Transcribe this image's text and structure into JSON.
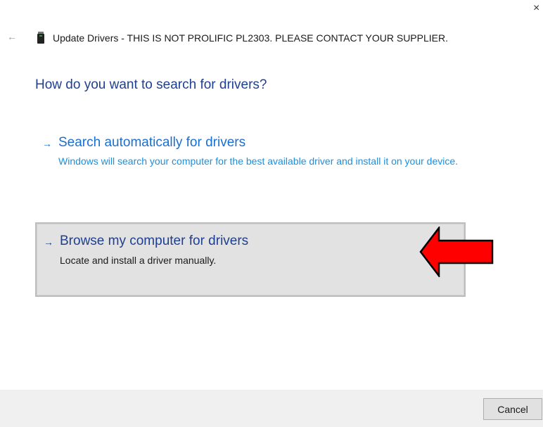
{
  "window": {
    "close_glyph": "×",
    "back_glyph": "←",
    "device_icon": "usb-device-icon",
    "title": "Update Drivers - THIS IS NOT PROLIFIC PL2303. PLEASE CONTACT YOUR SUPPLIER."
  },
  "main": {
    "question": "How do you want to search for drivers?",
    "options": [
      {
        "arrow": "→",
        "title": "Search automatically for drivers",
        "description": "Windows will search your computer for the best available driver and install it on your device."
      },
      {
        "arrow": "→",
        "title": "Browse my computer for drivers",
        "description": "Locate and install a driver manually.",
        "selected": true
      }
    ]
  },
  "annotation": {
    "icon": "red-arrow-pointer-icon",
    "color": "#ff0000"
  },
  "footer": {
    "cancel_label": "Cancel"
  },
  "colors": {
    "heading_blue": "#1f3f8f",
    "link_blue": "#1a6fd1",
    "selected_bg": "#e2e2e2",
    "footer_bg": "#f0f0f0"
  }
}
